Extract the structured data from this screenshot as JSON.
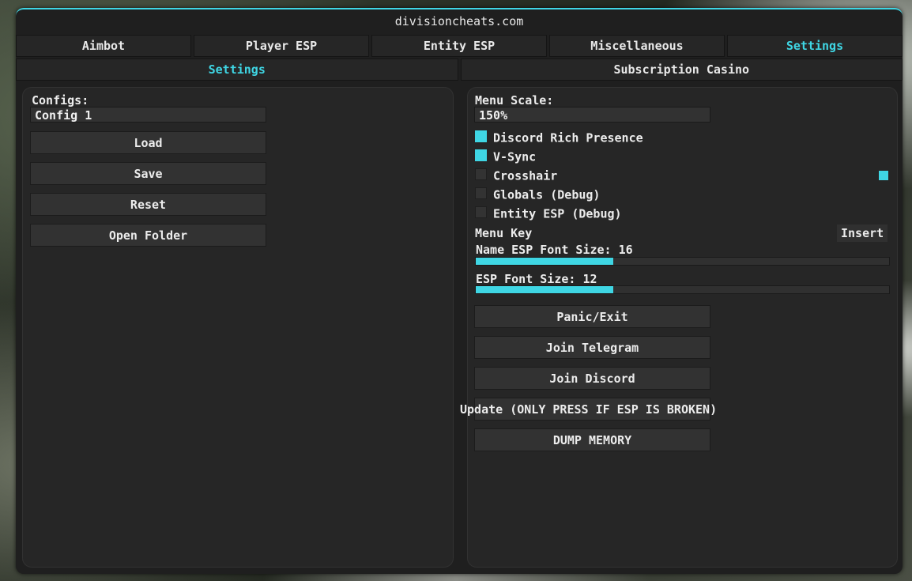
{
  "window": {
    "title": "divisioncheats.com"
  },
  "tabs": [
    {
      "label": "Aimbot"
    },
    {
      "label": "Player ESP"
    },
    {
      "label": "Entity ESP"
    },
    {
      "label": "Miscellaneous"
    },
    {
      "label": "Settings",
      "active": true
    }
  ],
  "subtabs": [
    {
      "label": "Settings",
      "active": true
    },
    {
      "label": "Subscription Casino"
    }
  ],
  "configs": {
    "label": "Configs:",
    "selected": "Config 1",
    "buttons": {
      "load": "Load",
      "save": "Save",
      "reset": "Reset",
      "open_folder": "Open Folder"
    }
  },
  "settings": {
    "menu_scale_label": "Menu Scale:",
    "menu_scale_value": "150%",
    "checkboxes": [
      {
        "label": "Discord Rich Presence",
        "checked": true
      },
      {
        "label": "V-Sync",
        "checked": true
      },
      {
        "label": "Crosshair",
        "checked": false
      },
      {
        "label": "Globals (Debug)",
        "checked": false
      },
      {
        "label": "Entity ESP (Debug)",
        "checked": false
      }
    ],
    "menu_key_label": "Menu Key",
    "menu_key_value": "Insert",
    "name_esp_font_label": "Name ESP Font Size: 16",
    "name_esp_font_fill": 0.333,
    "esp_font_label": "ESP Font Size: 12",
    "esp_font_fill": 0.333,
    "buttons": {
      "panic": "Panic/Exit",
      "telegram": "Join Telegram",
      "discord": "Join Discord",
      "update": "Update (ONLY PRESS IF ESP IS BROKEN)",
      "dump": "DUMP MEMORY"
    },
    "accent_color": "#3fd6e4"
  }
}
